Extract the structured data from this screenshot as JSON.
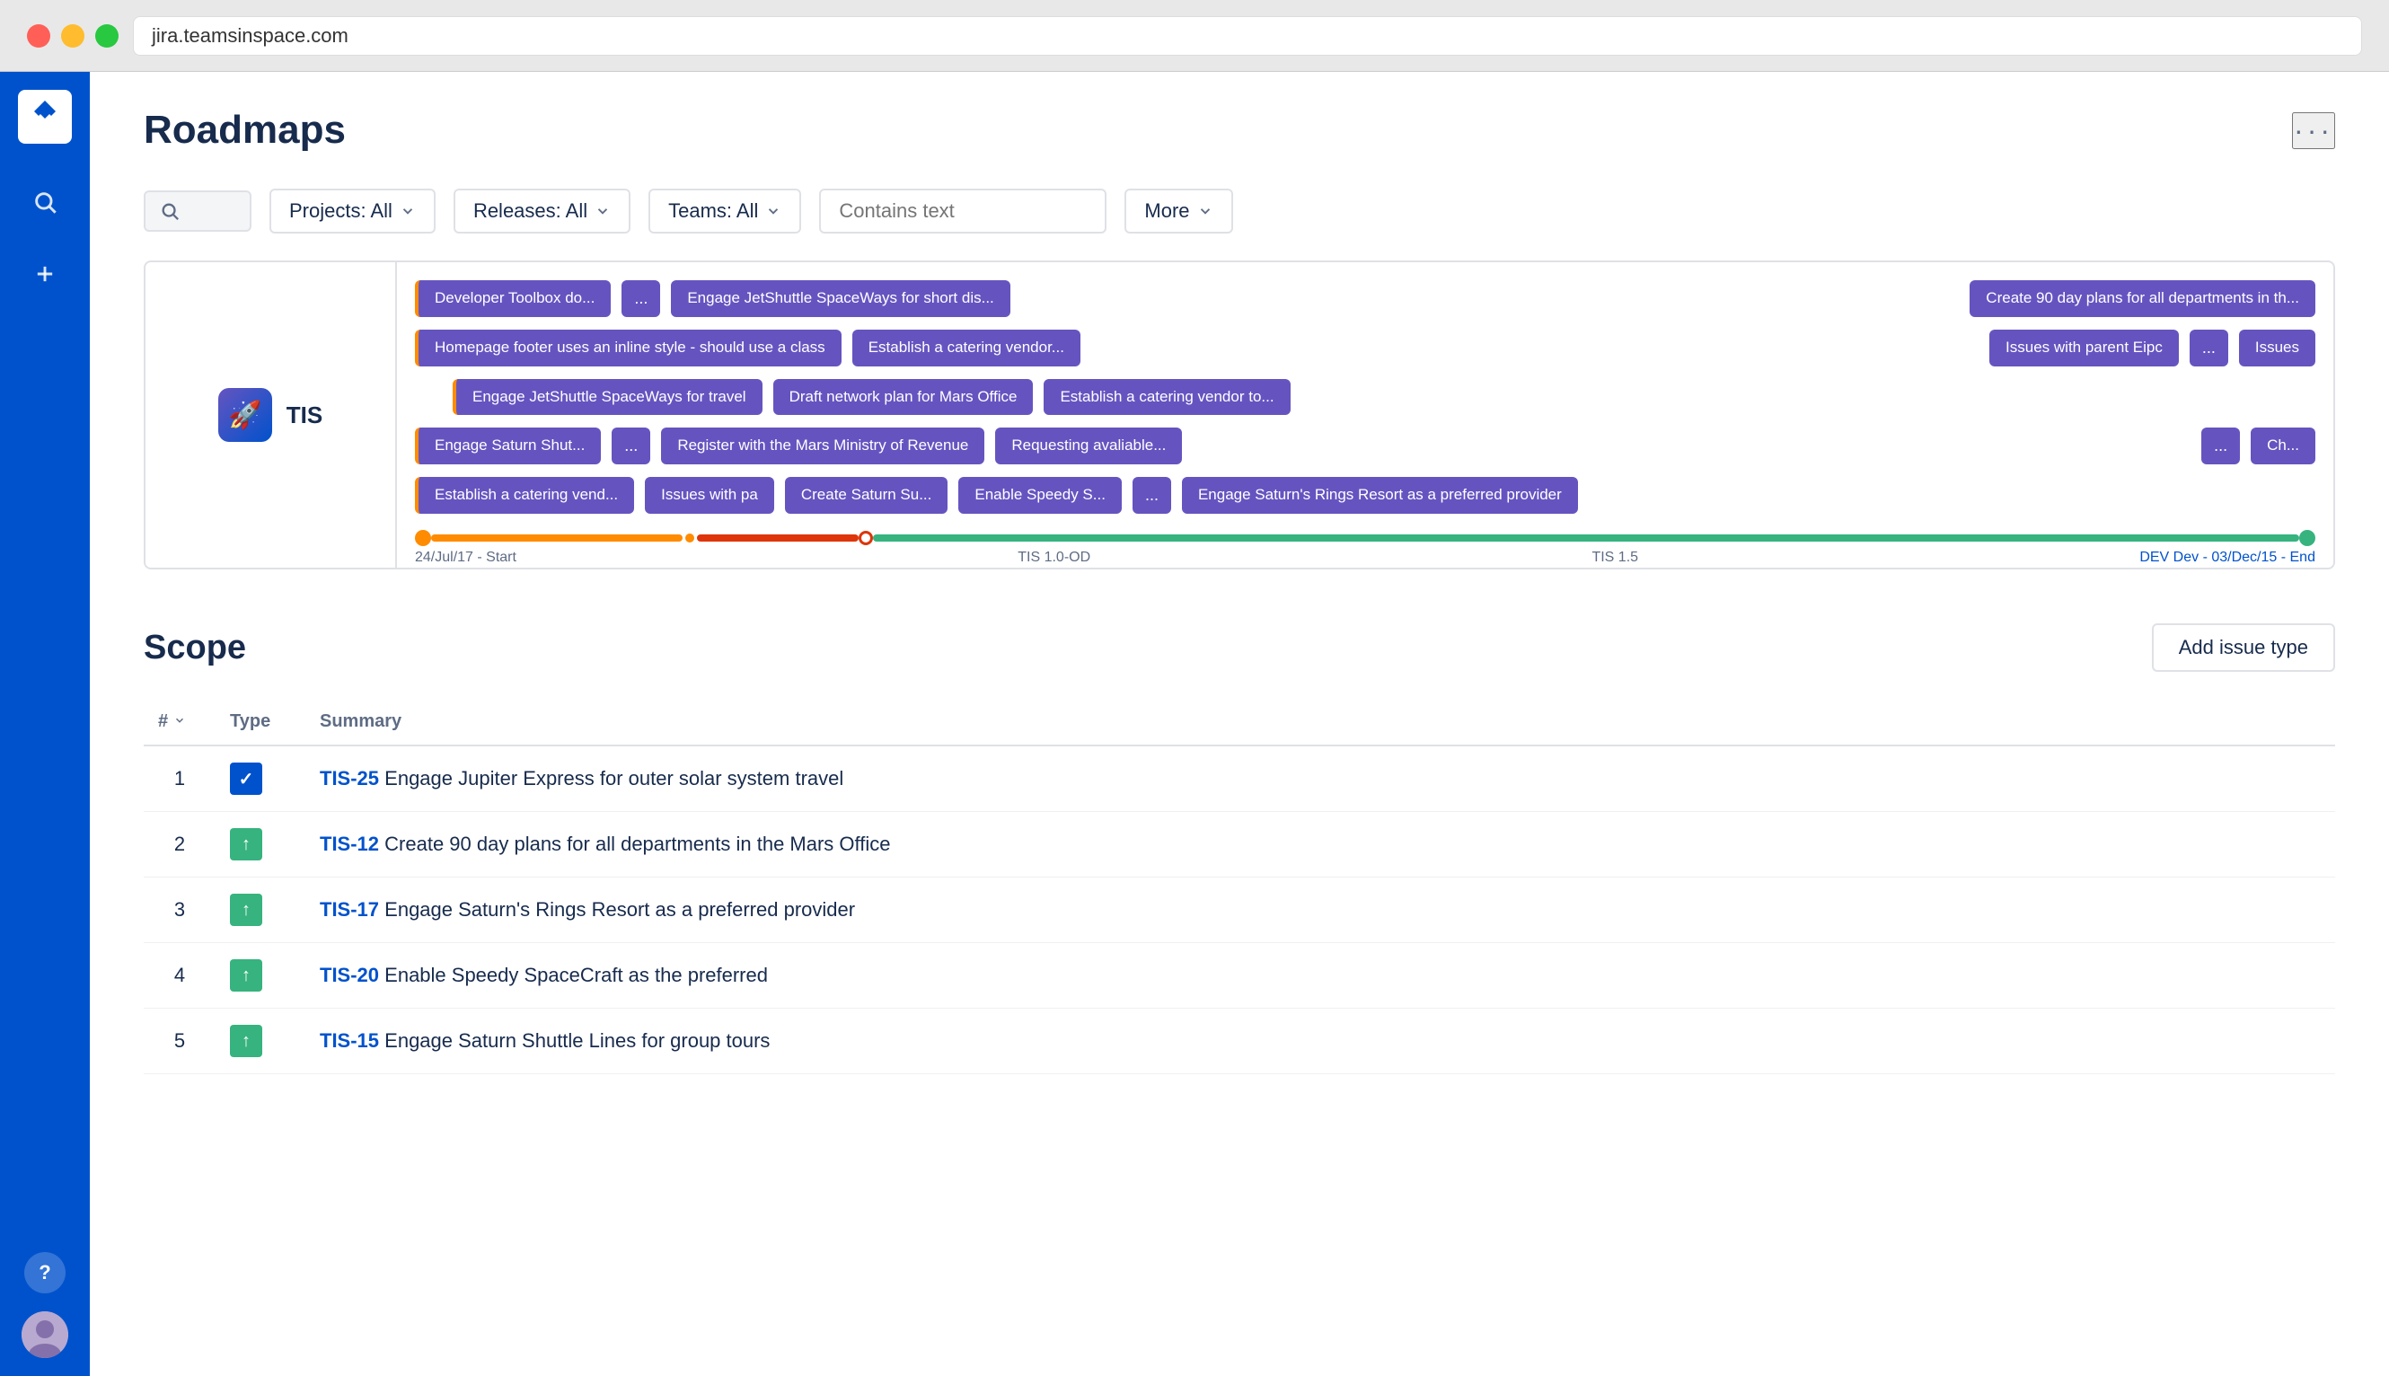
{
  "browser": {
    "url": "jira.teamsinspace.com"
  },
  "page": {
    "title": "Roadmaps",
    "more_options": "···"
  },
  "filters": {
    "search_placeholder": "Contains text",
    "projects_label": "Projects: All",
    "releases_label": "Releases: All",
    "teams_label": "Teams: All",
    "more_label": "More"
  },
  "roadmap": {
    "project_name": "TIS",
    "project_icon": "🚀",
    "rows": [
      {
        "chips": [
          {
            "label": "Developer Toolbox do...",
            "bordered": true
          },
          {
            "label": "...",
            "small": true
          },
          {
            "label": "Engage JetShuttle SpaceWays for short dis..."
          },
          {
            "label": "Create 90 day plans for all departments in th...",
            "far_right": true
          }
        ]
      },
      {
        "chips": [
          {
            "label": "Homepage footer uses an inline style - should use a class",
            "wide": true,
            "bordered": true
          },
          {
            "label": "Establish a catering vendor..."
          },
          {
            "label": "Issues with parent Eipc"
          },
          {
            "label": "...",
            "small": true
          },
          {
            "label": "Issues"
          }
        ]
      },
      {
        "chips": [
          {
            "label": "Engage JetShuttle SpaceWays for travel",
            "bordered": true
          },
          {
            "label": "Draft network plan for Mars Office"
          },
          {
            "label": "Establish a catering vendor to..."
          }
        ]
      },
      {
        "chips": [
          {
            "label": "Engage Saturn Shut...",
            "bordered": true
          },
          {
            "label": "...",
            "small": true
          },
          {
            "label": "Register with the Mars Ministry of Revenue"
          },
          {
            "label": "Requesting avaliable..."
          },
          {
            "label": "...",
            "small": true,
            "far_right": true
          },
          {
            "label": "Ch...",
            "far_right": true
          }
        ]
      },
      {
        "chips": [
          {
            "label": "Establish a catering vend...",
            "bordered": true
          },
          {
            "label": "Issues with pa"
          },
          {
            "label": "Create Saturn Su..."
          },
          {
            "label": "Enable Speedy S..."
          },
          {
            "label": "...",
            "small": true
          },
          {
            "label": "Engage Saturn's Rings Resort as a preferred provider"
          }
        ]
      }
    ],
    "timeline": {
      "start_label": "24/Jul/17 - Start",
      "mid1_label": "TIS 1.0-OD",
      "mid2_label": "TIS 1.5",
      "end_label": "DEV Dev - 03/Dec/15 - End"
    }
  },
  "scope": {
    "title": "Scope",
    "add_issue_label": "Add issue type",
    "columns": {
      "num": "#",
      "type": "Type",
      "summary": "Summary"
    },
    "issues": [
      {
        "num": "1",
        "type": "story",
        "issue_id": "TIS-25",
        "summary": "Engage Jupiter Express for outer solar system travel"
      },
      {
        "num": "2",
        "type": "task",
        "issue_id": "TIS-12",
        "summary": "Create 90 day plans for all departments in the Mars Office"
      },
      {
        "num": "3",
        "type": "task",
        "issue_id": "TIS-17",
        "summary": "Engage Saturn's Rings Resort as a preferred provider"
      },
      {
        "num": "4",
        "type": "task",
        "issue_id": "TIS-20",
        "summary": "Enable Speedy SpaceCraft as the preferred"
      },
      {
        "num": "5",
        "type": "task",
        "issue_id": "TIS-15",
        "summary": "Engage Saturn Shuttle Lines for group tours"
      }
    ]
  }
}
